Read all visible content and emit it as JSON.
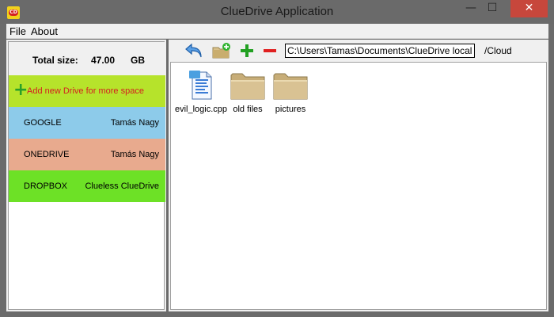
{
  "window": {
    "title": "ClueDrive Application",
    "controls": {
      "minimize": "—",
      "maximize": "☐",
      "close": "✕"
    }
  },
  "menu": {
    "items": [
      "File",
      "About"
    ]
  },
  "sidebar": {
    "total_label": "Total size:",
    "total_value": "47.00",
    "total_unit": "GB",
    "add_drive_label": "Add new Drive for more space",
    "drives": [
      {
        "name": "GOOGLE",
        "owner": "Tamás Nagy",
        "color": "#8dcbea"
      },
      {
        "name": "ONEDRIVE",
        "owner": "Tamás Nagy",
        "color": "#e8aa8e"
      },
      {
        "name": "DROPBOX",
        "owner": "Clueless ClueDrive",
        "color": "#6de126"
      }
    ]
  },
  "toolbar": {
    "icons": [
      "back-arrow-icon",
      "new-folder-icon",
      "add-icon",
      "remove-icon"
    ],
    "local_path": "C:\\Users\\Tamas\\Documents\\ClueDrive local files",
    "cloud_path": "/Cloud"
  },
  "files": [
    {
      "name": "evil_logic.cpp",
      "icon": "code-file-icon"
    },
    {
      "name": "old files",
      "icon": "folder-icon"
    },
    {
      "name": "pictures",
      "icon": "folder-icon"
    }
  ]
}
